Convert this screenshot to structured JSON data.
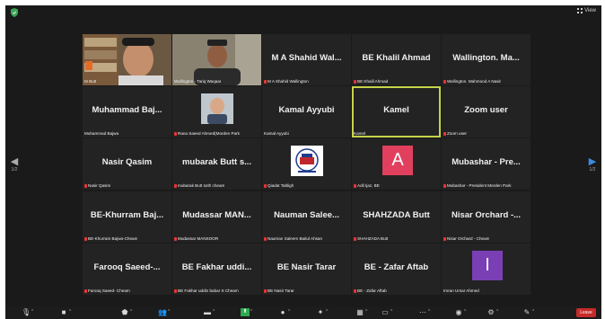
{
  "window": {
    "view_label": "View"
  },
  "pager": {
    "left_page": "1/2",
    "right_page": "1/2"
  },
  "tiles": [
    {
      "name": "",
      "sub": "M Butt",
      "muted": false,
      "kind": "photo-bookshelf"
    },
    {
      "name": "",
      "sub": "Wallington - Tariq Waqaar",
      "muted": false,
      "kind": "photo-man"
    },
    {
      "name": "M A Shahid Wal...",
      "sub": "M A Shahid Wallington",
      "muted": true,
      "kind": "name"
    },
    {
      "name": "BE Khalil Ahmad",
      "sub": "BE Khalil Ahmad",
      "muted": true,
      "kind": "name"
    },
    {
      "name": "Wallington. Ma...",
      "sub": "Wallington. Mahmood A Nasir",
      "muted": true,
      "kind": "name"
    },
    {
      "name": "Muhammad Baj...",
      "sub": "Muhammad Bajwa",
      "muted": false,
      "kind": "name"
    },
    {
      "name": "",
      "sub": "Rana Saeed Ahmed(Morden Park",
      "muted": true,
      "kind": "thumb-man"
    },
    {
      "name": "Kamal Ayyubi",
      "sub": "Kamal Ayyubi",
      "muted": false,
      "kind": "name"
    },
    {
      "name": "Kamel",
      "sub": "Kamel",
      "muted": false,
      "kind": "name",
      "active": true
    },
    {
      "name": "Zoom user",
      "sub": "Zoom user",
      "muted": true,
      "kind": "name"
    },
    {
      "name": "Nasir Qasim",
      "sub": "Nasir Qasim",
      "muted": true,
      "kind": "name"
    },
    {
      "name": "mubarak Butt s...",
      "sub": "mubarak Butt soth cheam",
      "muted": true,
      "kind": "name"
    },
    {
      "name": "",
      "sub": "Qiadat Tabligh",
      "muted": true,
      "kind": "logo"
    },
    {
      "name": "",
      "sub": "Adil Ijaz, BE",
      "muted": true,
      "kind": "avatar",
      "letter": "A"
    },
    {
      "name": "Mubashar - Pre...",
      "sub": "Mubashar - President Morden Park",
      "muted": true,
      "kind": "name"
    },
    {
      "name": "BE-Khurram Baj...",
      "sub": "BE-Khurram Bajwa-Cheam",
      "muted": true,
      "kind": "name"
    },
    {
      "name": "Mudassar MAN...",
      "sub": "Mudassar MANSOOR",
      "muted": true,
      "kind": "name"
    },
    {
      "name": "Nauman Salee...",
      "sub": "Nauman Saleem Baitul Ahsan",
      "muted": true,
      "kind": "name"
    },
    {
      "name": "SHAHZADA Butt",
      "sub": "SHAHZADA Butt",
      "muted": true,
      "kind": "name"
    },
    {
      "name": "Nisar Orchard -...",
      "sub": "Nisar Orchard - Cheam",
      "muted": true,
      "kind": "name"
    },
    {
      "name": "Farooq Saeed-...",
      "sub": "Farooq Saeed- Cheam",
      "muted": true,
      "kind": "name"
    },
    {
      "name": "BE Fakhar uddi...",
      "sub": "BE Fakhar uddin babar S Cheam",
      "muted": true,
      "kind": "name"
    },
    {
      "name": "BE Nasir Tarar",
      "sub": "BE Nasir Tarar",
      "muted": true,
      "kind": "name"
    },
    {
      "name": "BE - Zafar Aftab",
      "sub": "BE - Zafar Aftab",
      "muted": true,
      "kind": "name"
    },
    {
      "name": "",
      "sub": "Imran Umar Ahmed",
      "muted": false,
      "kind": "avatar",
      "letter": "I"
    }
  ],
  "colors": {
    "active_border": "#c6d44a",
    "avatar_a": "#e0405e",
    "avatar_i": "#7b3fb5",
    "leave": "#c92a2a"
  },
  "toolbar": {
    "leave_label": "Leave",
    "icons": [
      "mic-icon",
      "video-icon",
      "security-icon",
      "participants-icon",
      "chat-icon",
      "share-screen-icon",
      "record-icon",
      "reactions-icon",
      "apps-icon",
      "whiteboard-icon",
      "more-icon",
      "camera-icon",
      "settings-icon",
      "notes-icon"
    ]
  }
}
